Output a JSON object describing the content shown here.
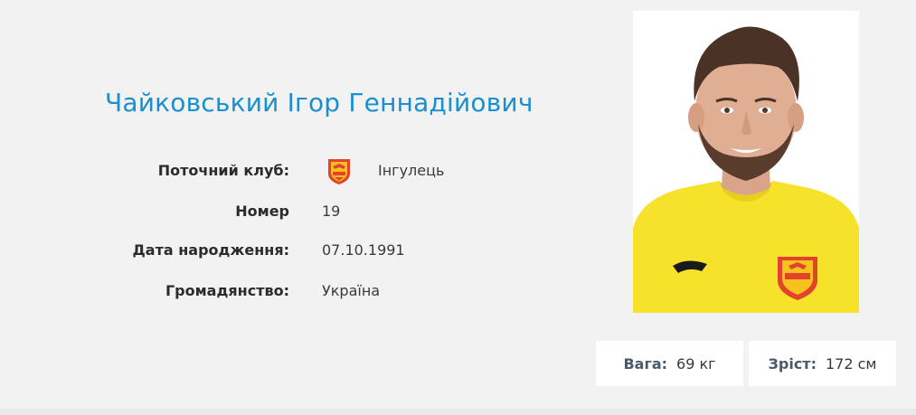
{
  "player": {
    "full_name": "Чайковський Ігор Геннадійович"
  },
  "info": {
    "club_label": "Поточний клуб:",
    "club_value": "Інгулець",
    "number_label": "Номер",
    "number_value": "19",
    "birth_label": "Дата народження:",
    "birth_value": "07.10.1991",
    "citizenship_label": "Громадянство:",
    "citizenship_value": "Україна"
  },
  "stats": {
    "weight_label": "Вага:",
    "weight_value": "69 кг",
    "height_label": "Зріст:",
    "height_value": "172 см"
  },
  "colors": {
    "name": "#1a8fcf",
    "club_primary": "#e2432a",
    "club_secondary": "#f7c21e",
    "shirt": "#f6e22a"
  },
  "icons": {
    "club_logo": "ingulets-crest-icon",
    "kit_brand": "joma-logo-icon"
  }
}
